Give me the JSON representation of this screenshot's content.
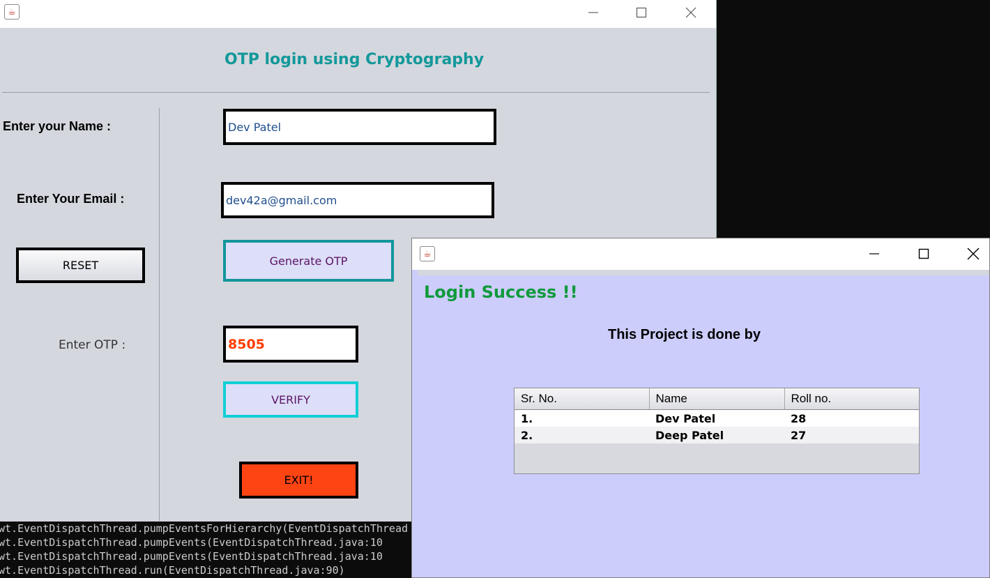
{
  "console": {
    "lines": [
      "wt.EventDispatchThread.pumpEventsForHierarchy(EventDispatchThread",
      "wt.EventDispatchThread.pumpEvents(EventDispatchThread.java:10",
      "wt.EventDispatchThread.pumpEvents(EventDispatchThread.java:10",
      "wt.EventDispatchThread.run(EventDispatchThread.java:90)"
    ]
  },
  "main_window": {
    "title": "",
    "heading": "OTP login using Cryptography",
    "name_label": "Enter your Name :",
    "name_value": "Dev Patel",
    "email_label": "Enter Your Email :",
    "email_value": "dev42a@gmail.com",
    "reset_label": "RESET",
    "generate_label": "Generate OTP",
    "otp_label": "Enter OTP :",
    "otp_value": "8505",
    "verify_label": "VERIFY",
    "exit_label": "EXIT!"
  },
  "dialog": {
    "title": "",
    "success_text": "Login Success !!",
    "subtitle": "This Project is done by",
    "table": {
      "headers": [
        "Sr. No.",
        "Name",
        "Roll no."
      ],
      "rows": [
        [
          "1.",
          "Dev Patel",
          "28"
        ],
        [
          "2.",
          "Deep Patel",
          "27"
        ]
      ]
    }
  },
  "icons": {
    "app": "java-cup-icon",
    "minimize": "minimize-icon",
    "maximize": "maximize-icon",
    "close": "close-icon"
  },
  "colors": {
    "heading": "#13989a",
    "success": "#109a3c",
    "otp_value": "#ff3d00",
    "field_text": "#1f4e8c",
    "generate_border": "#13969b",
    "verify_border": "#11cfd6",
    "exit_bg": "#ff4413",
    "dialog_bg": "#cccdfb",
    "window_bg": "#d4d7de"
  }
}
